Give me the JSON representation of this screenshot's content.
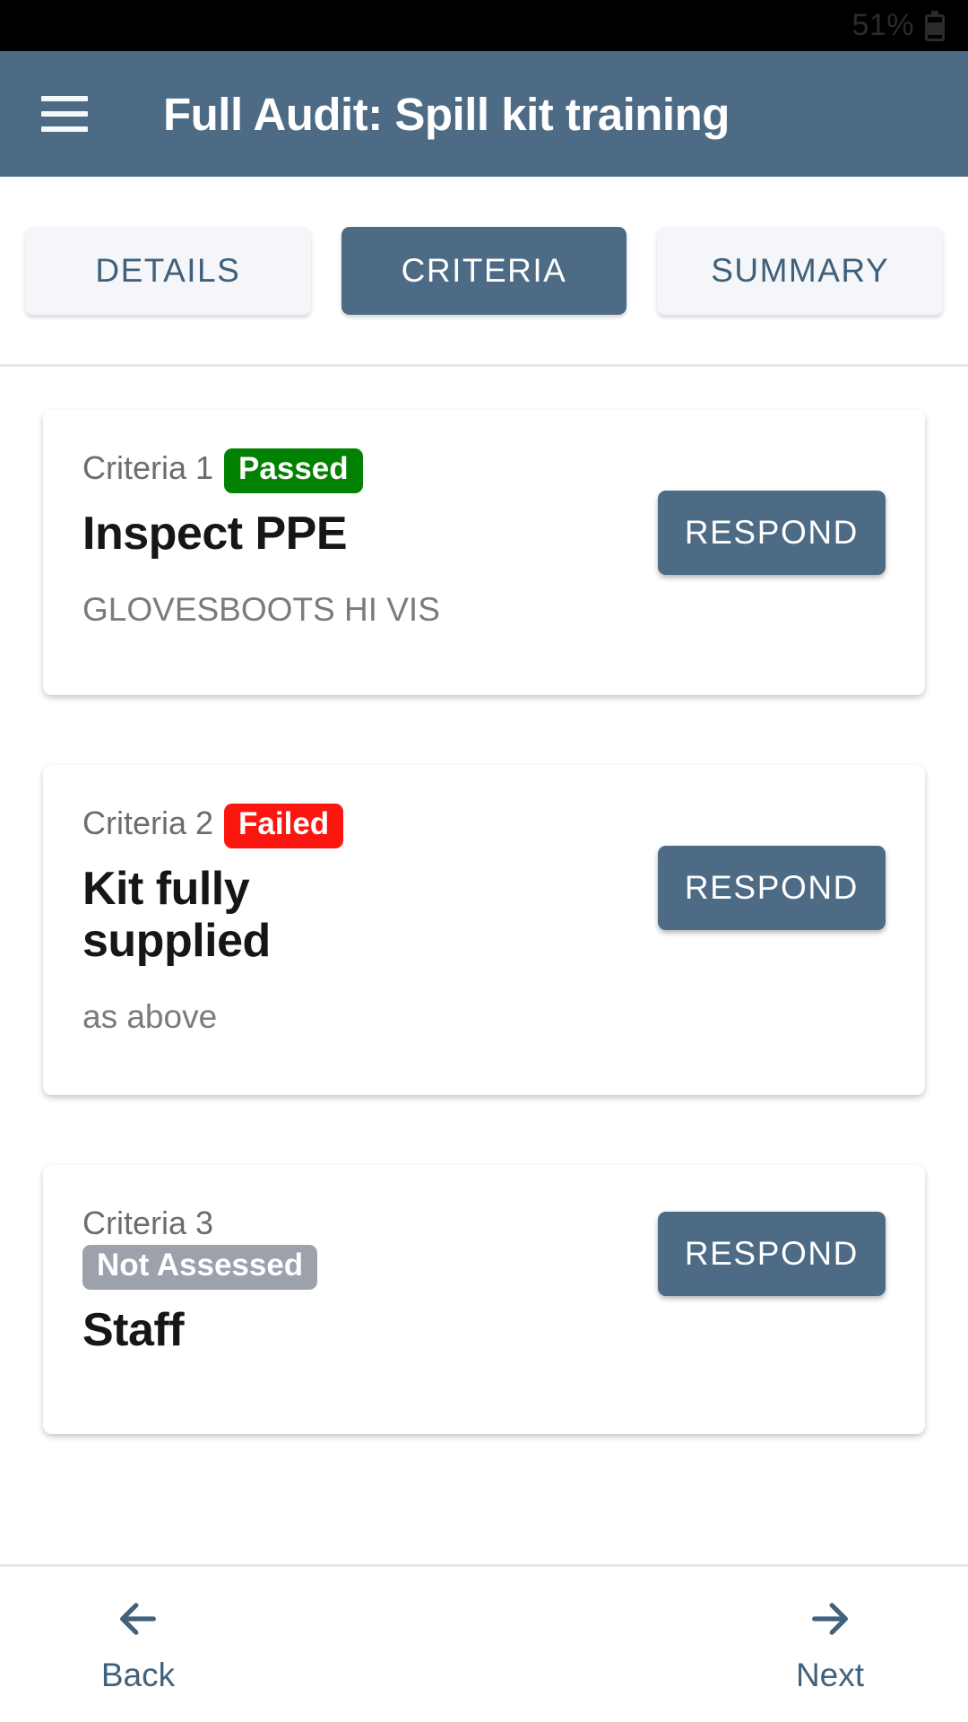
{
  "statusbar": {
    "battery_percent": "51%",
    "battery_icon": "battery-icon"
  },
  "appbar": {
    "menu_icon": "hamburger-menu-icon",
    "title": "Full Audit: Spill kit training",
    "background_color": "#4d6b85"
  },
  "tabs": [
    {
      "label": "DETAILS",
      "active": false
    },
    {
      "label": "CRITERIA",
      "active": true
    },
    {
      "label": "SUMMARY",
      "active": false
    }
  ],
  "criteria_cards": [
    {
      "criteria_label": "Criteria 1",
      "status": "Passed",
      "status_color": "#028102",
      "title": "Inspect PPE",
      "description": "GLOVESBOOTS HI VIS",
      "action_label": "RESPOND"
    },
    {
      "criteria_label": "Criteria 2",
      "status": "Failed",
      "status_color": "#fb1610",
      "title": "Kit fully supplied",
      "description": "as above",
      "action_label": "RESPOND"
    },
    {
      "criteria_label": "Criteria 3",
      "status": "Not Assessed",
      "status_color": "#9ca1ac",
      "title": "Staff",
      "description": "",
      "action_label": "RESPOND"
    }
  ],
  "bottomnav": {
    "back": {
      "label": "Back",
      "icon": "arrow-left-icon"
    },
    "next": {
      "label": "Next",
      "icon": "arrow-right-icon"
    },
    "accent_color": "#41627c"
  }
}
